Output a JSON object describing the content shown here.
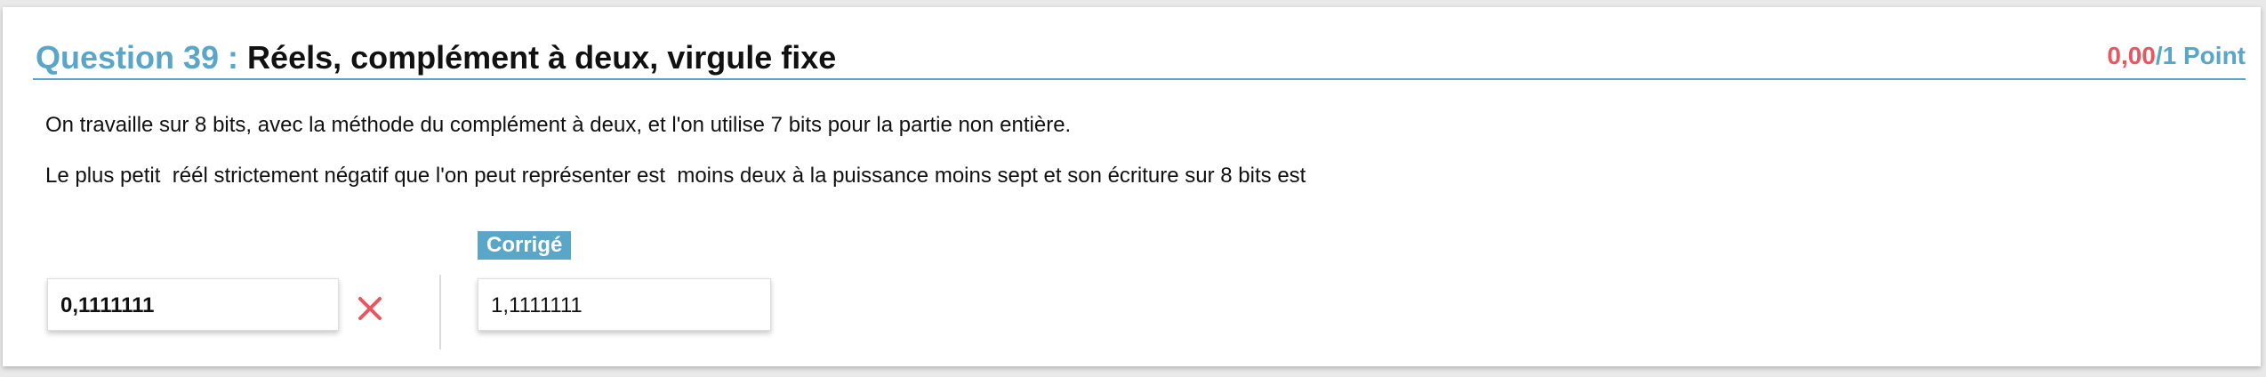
{
  "question": {
    "label": "Question 39 : ",
    "title": "Réels, complément à deux, virgule fixe",
    "score_obtained": "0,00",
    "score_total": "/1 Point"
  },
  "body": {
    "paragraph1": "On travaille sur 8 bits, avec la méthode du complément à deux, et l'on utilise 7 bits pour la partie non entière.",
    "paragraph2": "Le plus petit  réél strictement négatif que l'on peut représenter est  moins deux à la puissance moins sept et son écriture sur 8 bits est"
  },
  "answer": {
    "value": "0,1111111",
    "status_icon": "cross-icon",
    "status_color": "#e8565f"
  },
  "correction": {
    "label": "Corrigé",
    "value": "1,1111111"
  },
  "colors": {
    "accent": "#5aa6c8",
    "error": "#e8565f"
  }
}
